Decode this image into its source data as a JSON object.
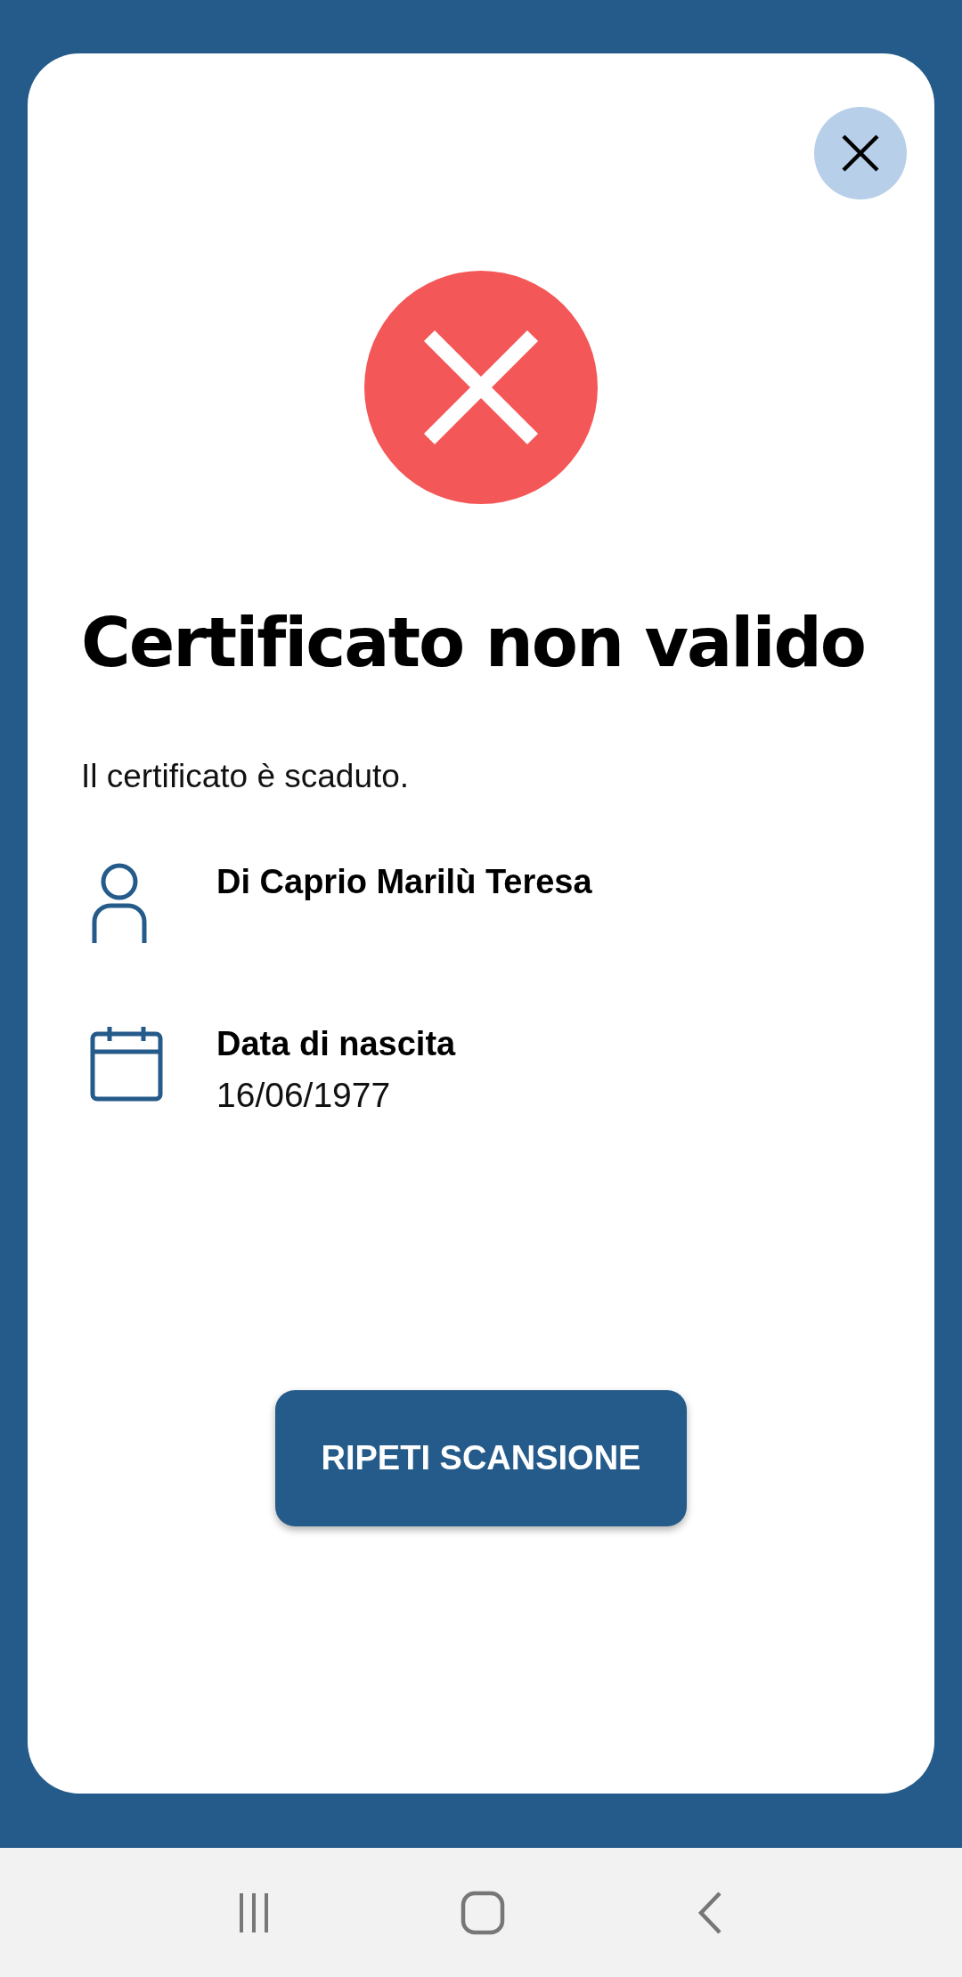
{
  "result": {
    "valid": false,
    "title": "Certificato non valido",
    "message": "Il certificato è scaduto."
  },
  "details": [
    {
      "kind": "person",
      "label": "Di Caprio Marilù Teresa"
    },
    {
      "kind": "birthdate",
      "label": "Data di nascita",
      "value": "16/06/1977"
    }
  ],
  "button": "RIPETI SCANSIONE"
}
